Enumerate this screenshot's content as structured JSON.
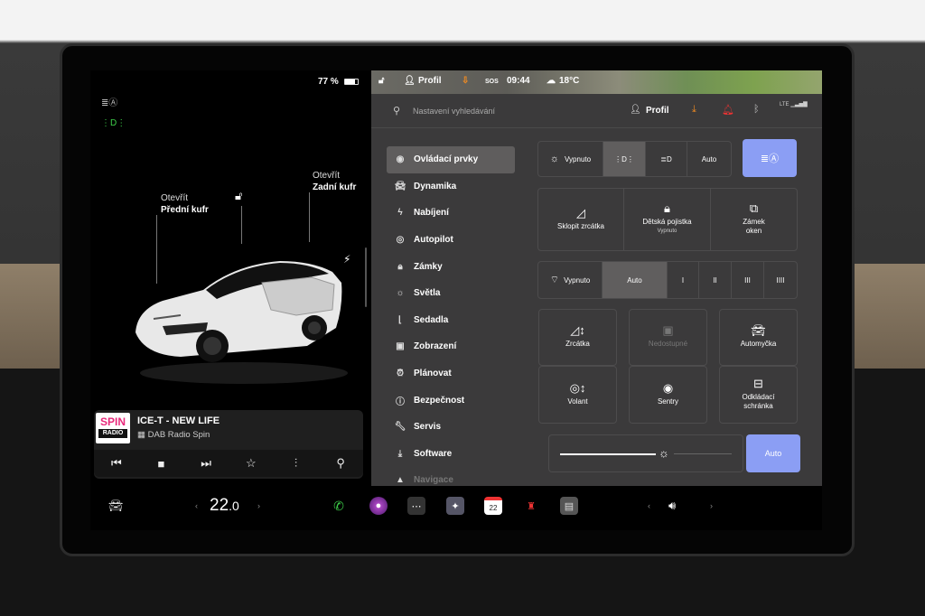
{
  "status": {
    "battery": "77 %",
    "battery_level": 0.77
  },
  "car_view": {
    "front_trunk_action": "Otevřít",
    "front_trunk_name": "Přední kufr",
    "rear_trunk_action": "Otevřít",
    "rear_trunk_name": "Zadní kufr"
  },
  "media": {
    "logo_top": "SPIN",
    "logo_bottom": "RADIO",
    "song": "ICE-T - NEW LIFE",
    "station": "DAB Radio Spin",
    "controls": [
      "previous-icon",
      "stop-icon",
      "next-icon",
      "favorite-icon",
      "equalizer-icon",
      "search-icon"
    ]
  },
  "top_strip": {
    "profile": "Profil",
    "time": "09:44",
    "temperature": "18°C"
  },
  "search": {
    "placeholder": "Nastavení vyhledávání",
    "profile_label": "Profil",
    "network": "LTE"
  },
  "menu": [
    {
      "label": "Ovládací prvky",
      "icon": "toggle-icon"
    },
    {
      "label": "Dynamika",
      "icon": "car-icon"
    },
    {
      "label": "Nabíjení",
      "icon": "bolt-icon"
    },
    {
      "label": "Autopilot",
      "icon": "steering-wheel-icon"
    },
    {
      "label": "Zámky",
      "icon": "lock-icon"
    },
    {
      "label": "Světla",
      "icon": "light-icon"
    },
    {
      "label": "Sedadla",
      "icon": "seat-icon"
    },
    {
      "label": "Zobrazení",
      "icon": "display-icon"
    },
    {
      "label": "Plánovat",
      "icon": "clock-icon"
    },
    {
      "label": "Bezpečnost",
      "icon": "alert-icon"
    },
    {
      "label": "Servis",
      "icon": "wrench-icon"
    },
    {
      "label": "Software",
      "icon": "download-icon"
    },
    {
      "label": "Navigace",
      "icon": "navigation-icon"
    }
  ],
  "lights": {
    "off": "Vypnuto",
    "auto": "Auto"
  },
  "actions": {
    "fold_mirrors": "Sklopit zrcátka",
    "child_lock": "Dětská pojistka",
    "child_lock_state": "Vypnuto",
    "window_lock_1": "Zámek",
    "window_lock_2": "oken"
  },
  "wipers": {
    "off": "Vypnuto",
    "auto": "Auto",
    "levels": [
      "I",
      "II",
      "III",
      "IIII"
    ]
  },
  "grid": {
    "mirrors": "Zrcátka",
    "unavailable": "Nedostupné",
    "car_wash": "Automyčka",
    "wheel": "Volant",
    "sentry": "Sentry",
    "glovebox_1": "Odkládací",
    "glovebox_2": "schránka"
  },
  "brightness": {
    "auto": "Auto",
    "level": 0.55
  },
  "dock": {
    "temperature_int": "22",
    "temperature_dec": ".0",
    "calendar_day": "22"
  }
}
